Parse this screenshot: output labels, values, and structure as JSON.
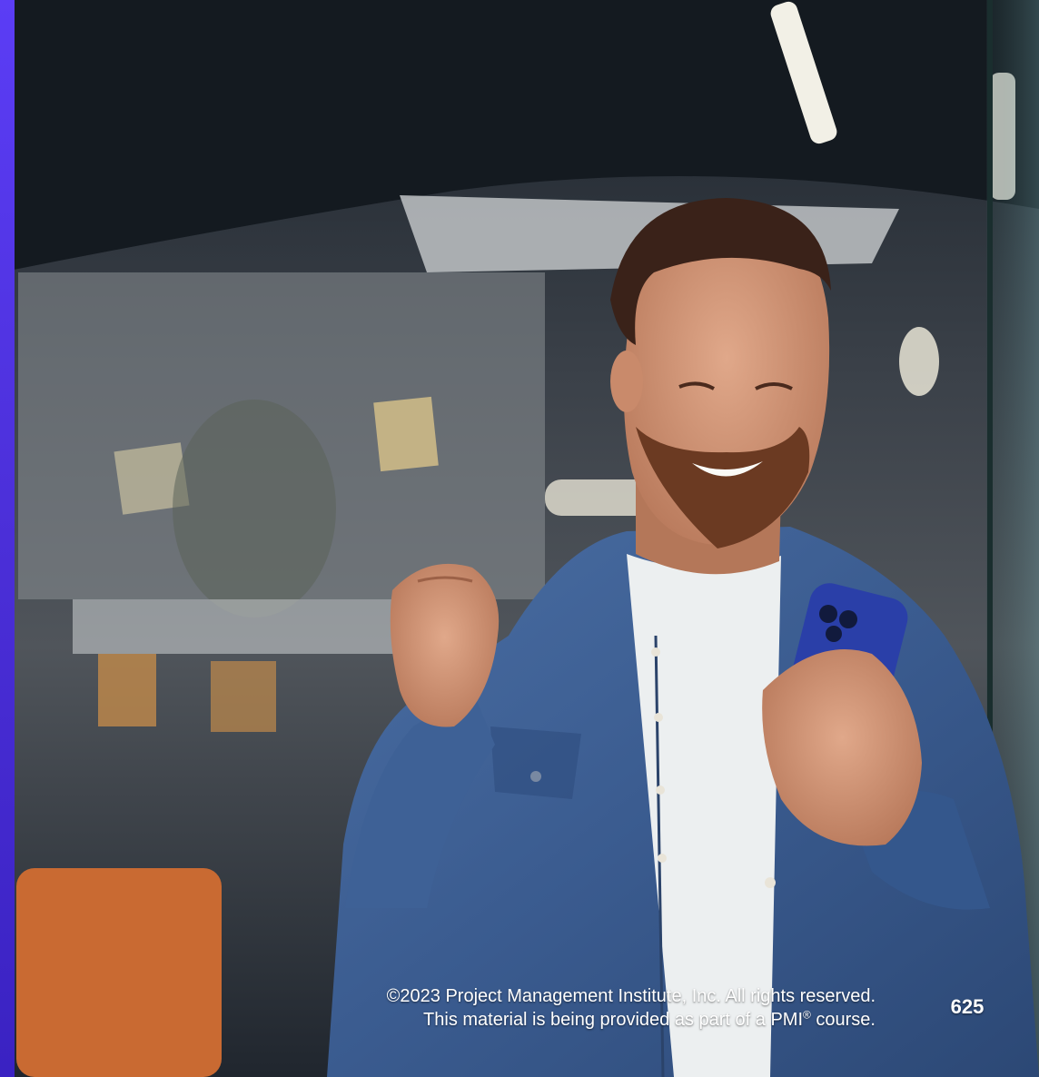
{
  "photo": {
    "subject": "man-celebrating-with-phone"
  },
  "footer": {
    "copyright": "©2023 Project Management Institute, Inc. All rights reserved.",
    "course_prefix": "This material is being provided as part of a PMI",
    "course_mark": "®",
    "course_suffix": " course."
  },
  "page_number": "625",
  "colors": {
    "accent": "#4b2fd8",
    "shirt": "#3d5f92",
    "phone": "#2a3fa8"
  }
}
